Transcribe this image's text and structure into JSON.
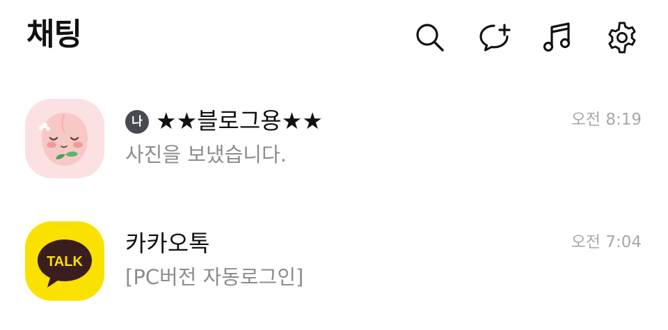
{
  "header": {
    "title": "채팅",
    "icons": [
      "search-icon",
      "new-chat-icon",
      "music-icon",
      "settings-icon"
    ]
  },
  "chats": [
    {
      "badge": "나",
      "name": "★★블로그용★★",
      "preview": "사진을 보냈습니다.",
      "time": "오전 8:19",
      "avatar": "peach-character-avatar"
    },
    {
      "name": "카카오톡",
      "preview": "[PC버전 자동로그인]",
      "time": "오전 7:04",
      "avatar": "kakaotalk-logo-avatar",
      "avatar_logo_text": "TALK"
    }
  ],
  "colors": {
    "title": "#111111",
    "preview": "#8c8c8c",
    "time": "#a8a8a8",
    "badge_bg": "#474a50",
    "kakao_yellow": "#FAE100",
    "kakao_brown": "#3A1D1D",
    "peach_bg": "#FBE1E1"
  }
}
